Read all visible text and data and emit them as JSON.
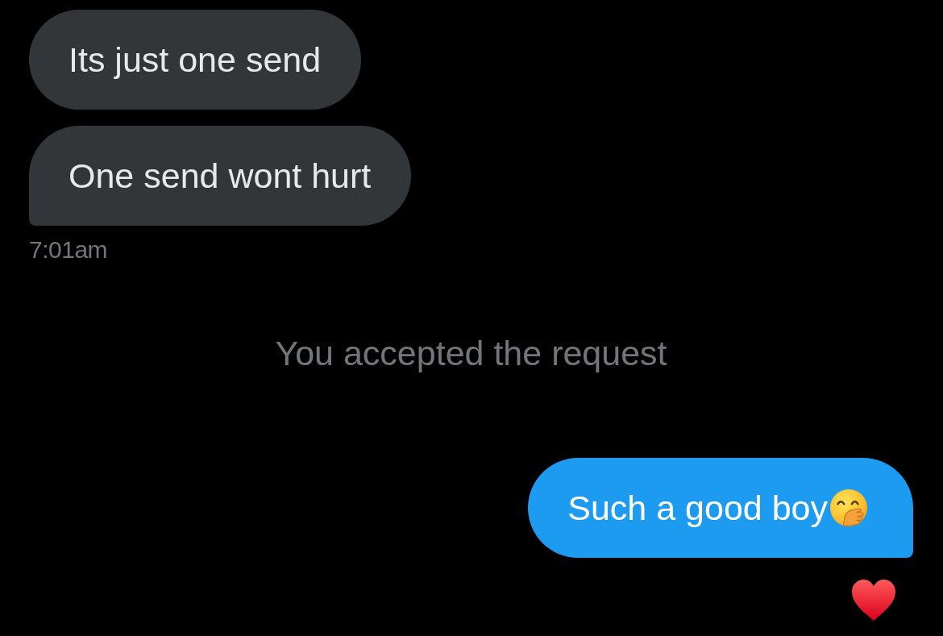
{
  "incoming": {
    "messages": [
      {
        "text": "Its just one send",
        "liked": false,
        "emoji": false
      },
      {
        "text": "One send wont hurt",
        "liked": false,
        "emoji": false
      }
    ],
    "time": "7:01am"
  },
  "notice": "You accepted the request",
  "outgoing": {
    "messages": [
      {
        "text": "Such a good boy",
        "liked": true,
        "emoji": true
      }
    ]
  }
}
